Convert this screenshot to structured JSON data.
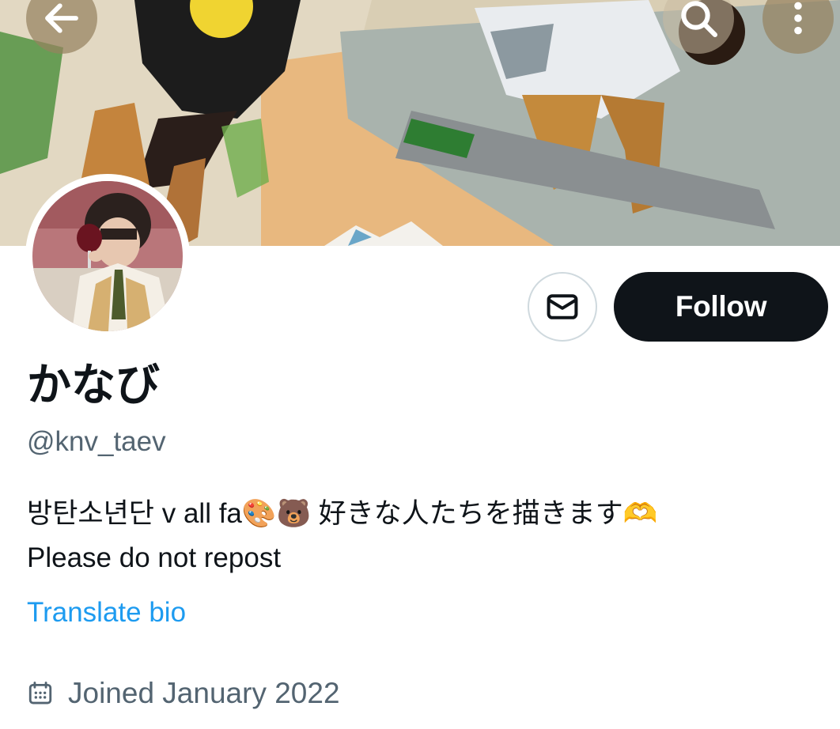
{
  "header": {
    "back_icon": "arrow-left-icon",
    "search_icon": "search-icon",
    "more_icon": "more-vertical-icon"
  },
  "profile": {
    "display_name": "かなび",
    "handle": "@knv_taev",
    "bio_line_1": "방탄소년단 v all fa🎨🐻 好きな人たちを描きます🫶",
    "bio_line_2": "Please do not repost",
    "translate_label": "Translate bio",
    "joined": "Joined January 2022"
  },
  "actions": {
    "message_icon": "envelope-icon",
    "follow_label": "Follow"
  },
  "colors": {
    "primary_button": "#0f1419",
    "link": "#1d9bf0",
    "secondary_text": "#536471",
    "border": "#cfd9de"
  }
}
